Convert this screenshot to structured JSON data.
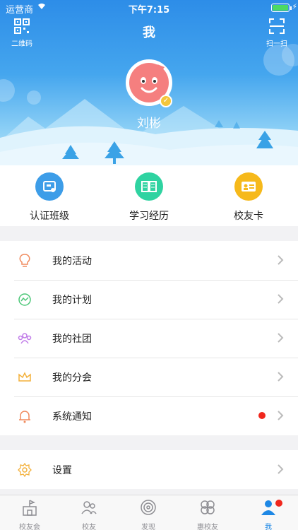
{
  "status_bar": {
    "carrier": "运营商",
    "time": "下午7:15"
  },
  "nav": {
    "title": "我",
    "left_label": "二维码",
    "right_label": "扫一扫"
  },
  "profile": {
    "name": "刘彬"
  },
  "quick_actions": [
    {
      "label": "认证班级",
      "icon": "certified-class-icon",
      "color": "#3d9de8"
    },
    {
      "label": "学习经历",
      "icon": "book-icon",
      "color": "#2fd3a1"
    },
    {
      "label": "校友卡",
      "icon": "id-card-icon",
      "color": "#f6b91b"
    }
  ],
  "menu": [
    {
      "label": "我的活动",
      "icon": "lightbulb-icon"
    },
    {
      "label": "我的计划",
      "icon": "trend-icon"
    },
    {
      "label": "我的社团",
      "icon": "group-icon"
    },
    {
      "label": "我的分会",
      "icon": "crown-icon"
    },
    {
      "label": "系统通知",
      "icon": "bell-icon"
    }
  ],
  "settings": {
    "label": "设置",
    "icon": "gear-icon"
  },
  "tabbar": [
    {
      "label": "校友会",
      "icon": "alumni-building-icon"
    },
    {
      "label": "校友",
      "icon": "people-icon"
    },
    {
      "label": "发现",
      "icon": "discover-icon"
    },
    {
      "label": "惠校友",
      "icon": "clover-icon"
    },
    {
      "label": "我",
      "icon": "person-icon",
      "active": true
    }
  ]
}
